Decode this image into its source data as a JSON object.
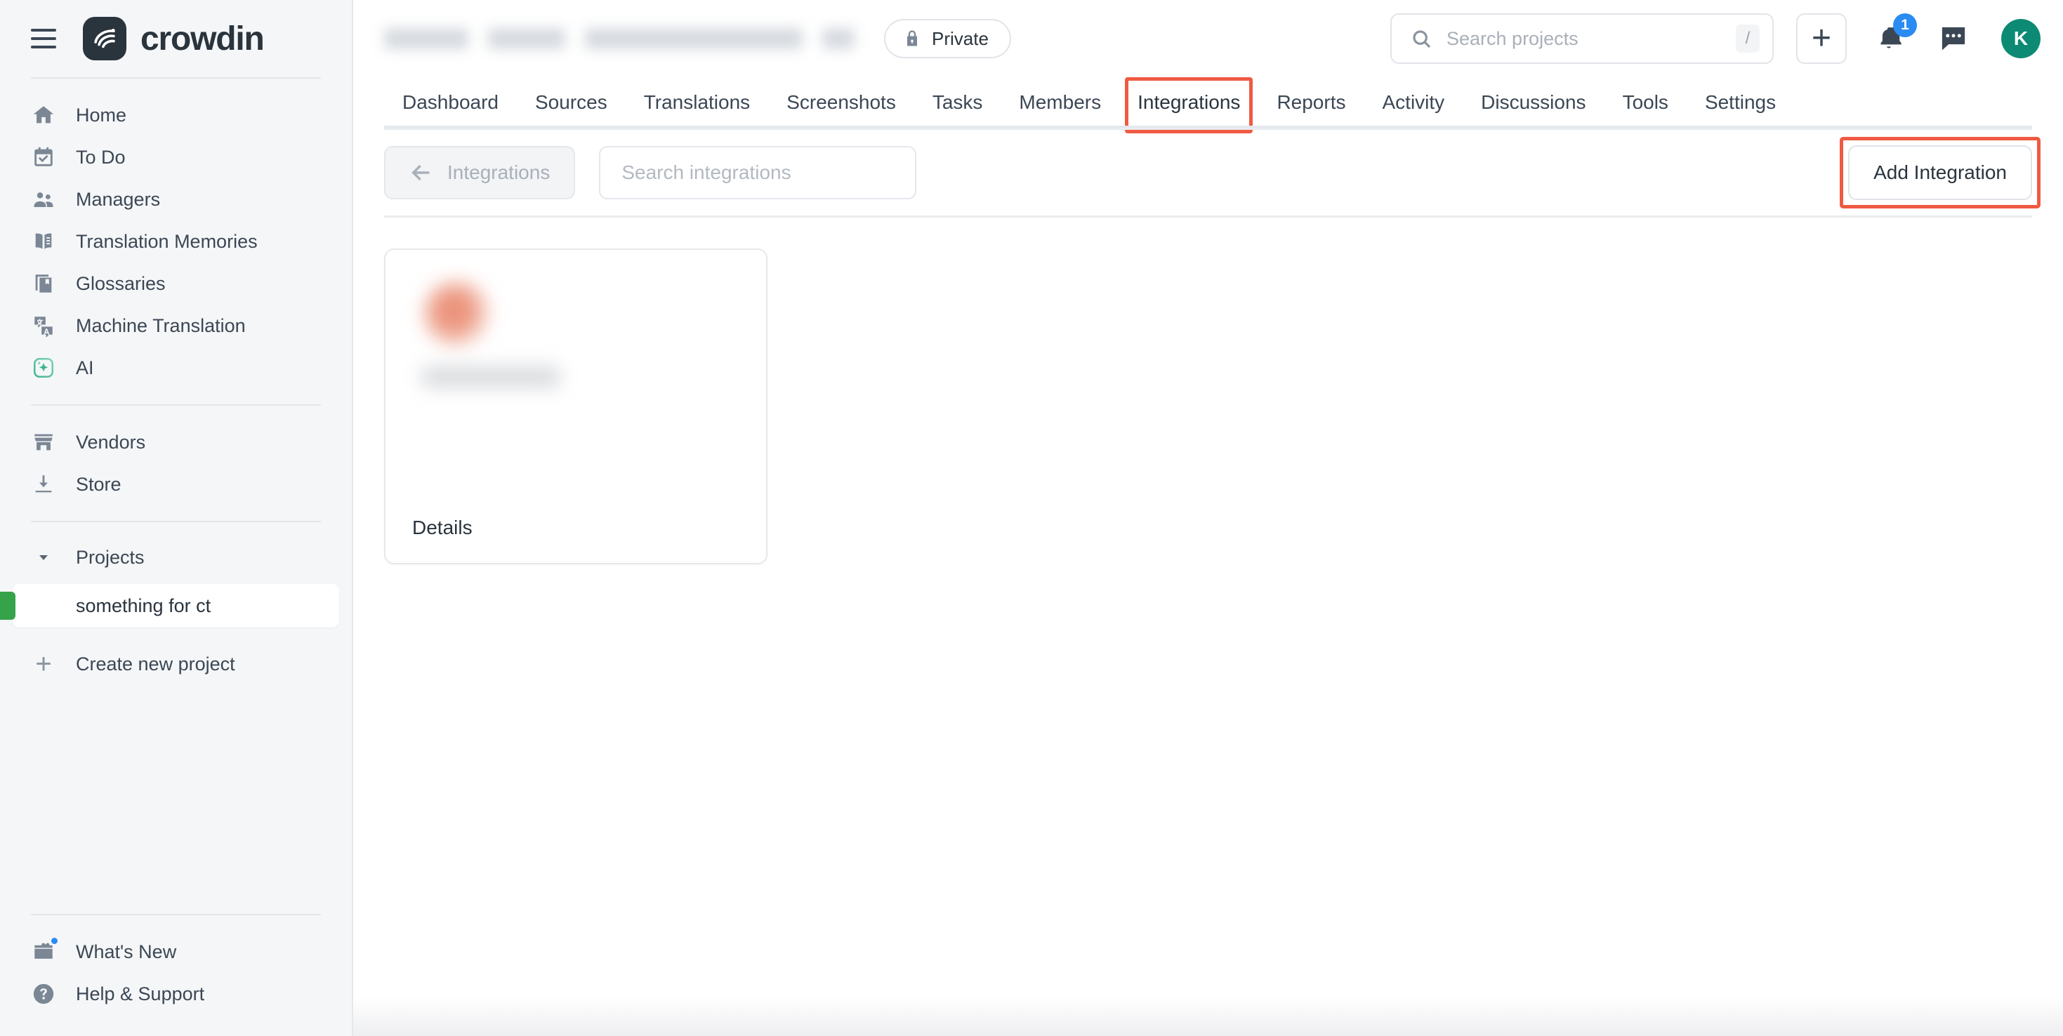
{
  "brand": {
    "name": "crowdin",
    "logo_icon": "crowdin-logo-icon",
    "menu_icon": "hamburger-menu-icon"
  },
  "sidebar": {
    "primary_items": [
      {
        "label": "Home",
        "icon": "home-icon"
      },
      {
        "label": "To Do",
        "icon": "calendar-check-icon"
      },
      {
        "label": "Managers",
        "icon": "people-icon"
      },
      {
        "label": "Translation Memories",
        "icon": "open-book-icon"
      },
      {
        "label": "Glossaries",
        "icon": "bookmark-book-icon"
      },
      {
        "label": "Machine Translation",
        "icon": "translate-icon"
      },
      {
        "label": "AI",
        "icon": "ai-sparkle-icon"
      }
    ],
    "secondary_items": [
      {
        "label": "Vendors",
        "icon": "storefront-icon"
      },
      {
        "label": "Store",
        "icon": "download-icon"
      }
    ],
    "projects_section": {
      "label": "Projects",
      "caret_icon": "caret-down-icon",
      "expanded": true,
      "projects": [
        {
          "label": "something for ct",
          "active": true,
          "accent_color": "#35a34a"
        }
      ],
      "create_label": "Create new project",
      "create_icon": "plus-icon"
    },
    "bottom_items": [
      {
        "label": "What's New",
        "icon": "gift-card-icon",
        "has_dot": true,
        "dot_color": "#2a8bf2"
      },
      {
        "label": "Help & Support",
        "icon": "question-circle-icon",
        "has_dot": false
      }
    ]
  },
  "header": {
    "breadcrumb_redacted": true,
    "visibility_badge": {
      "label": "Private",
      "icon": "lock-icon"
    },
    "search": {
      "placeholder": "Search projects",
      "value": "",
      "icon": "search-icon",
      "shortcut_key": "/"
    },
    "add_button_icon": "plus-icon",
    "notifications": {
      "icon": "bell-icon",
      "count": "1",
      "badge_color": "#2a8bf2"
    },
    "messages_icon": "chat-bubble-icon",
    "avatar": {
      "initial": "K",
      "color": "#0d8a74"
    }
  },
  "tabs": [
    {
      "label": "Dashboard",
      "active": false,
      "highlighted": false
    },
    {
      "label": "Sources",
      "active": false,
      "highlighted": false
    },
    {
      "label": "Translations",
      "active": false,
      "highlighted": false
    },
    {
      "label": "Screenshots",
      "active": false,
      "highlighted": false
    },
    {
      "label": "Tasks",
      "active": false,
      "highlighted": false
    },
    {
      "label": "Members",
      "active": false,
      "highlighted": false
    },
    {
      "label": "Integrations",
      "active": true,
      "highlighted": true
    },
    {
      "label": "Reports",
      "active": false,
      "highlighted": false
    },
    {
      "label": "Activity",
      "active": false,
      "highlighted": false
    },
    {
      "label": "Discussions",
      "active": false,
      "highlighted": false
    },
    {
      "label": "Tools",
      "active": false,
      "highlighted": false
    },
    {
      "label": "Settings",
      "active": false,
      "highlighted": false
    }
  ],
  "toolbar": {
    "back_button": {
      "label": "Integrations",
      "icon": "arrow-left-icon"
    },
    "search": {
      "placeholder": "Search integrations",
      "value": ""
    },
    "add_integration_label": "Add Integration",
    "highlight_color": "#ef5a43"
  },
  "content": {
    "cards": [
      {
        "name_redacted": true,
        "logo_redacted": true,
        "details_label": "Details"
      }
    ]
  }
}
